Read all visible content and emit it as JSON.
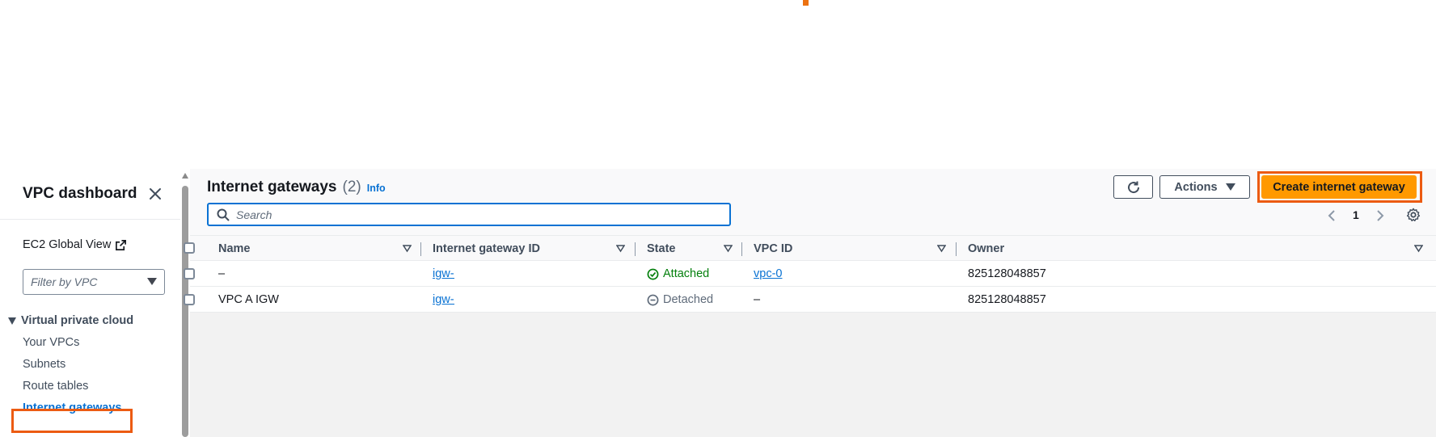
{
  "sidebar": {
    "title": "VPC dashboard",
    "ec2_global_view": "EC2 Global View",
    "filter_placeholder": "Filter by VPC",
    "section": "Virtual private cloud",
    "items": [
      {
        "label": "Your VPCs"
      },
      {
        "label": "Subnets"
      },
      {
        "label": "Route tables"
      },
      {
        "label": "Internet gateways"
      }
    ]
  },
  "header": {
    "title": "Internet gateways",
    "count": "(2)",
    "info": "Info",
    "actions_label": "Actions",
    "create_label": "Create internet gateway",
    "search_placeholder": "Search",
    "page": "1"
  },
  "table": {
    "columns": [
      "Name",
      "Internet gateway ID",
      "State",
      "VPC ID",
      "Owner"
    ],
    "rows": [
      {
        "name": "–",
        "igw_id": "igw-(",
        "state": "Attached",
        "vpc_id": "vpc-0",
        "owner": "825128048857"
      },
      {
        "name": "VPC A IGW",
        "igw_id": "igw-(",
        "state": "Detached",
        "vpc_id": "–",
        "owner": "825128048857"
      }
    ]
  },
  "colors": {
    "accent": "#0972d3",
    "primary": "#ff9900",
    "highlight": "#ec5b12",
    "attached": "#037f0c"
  }
}
